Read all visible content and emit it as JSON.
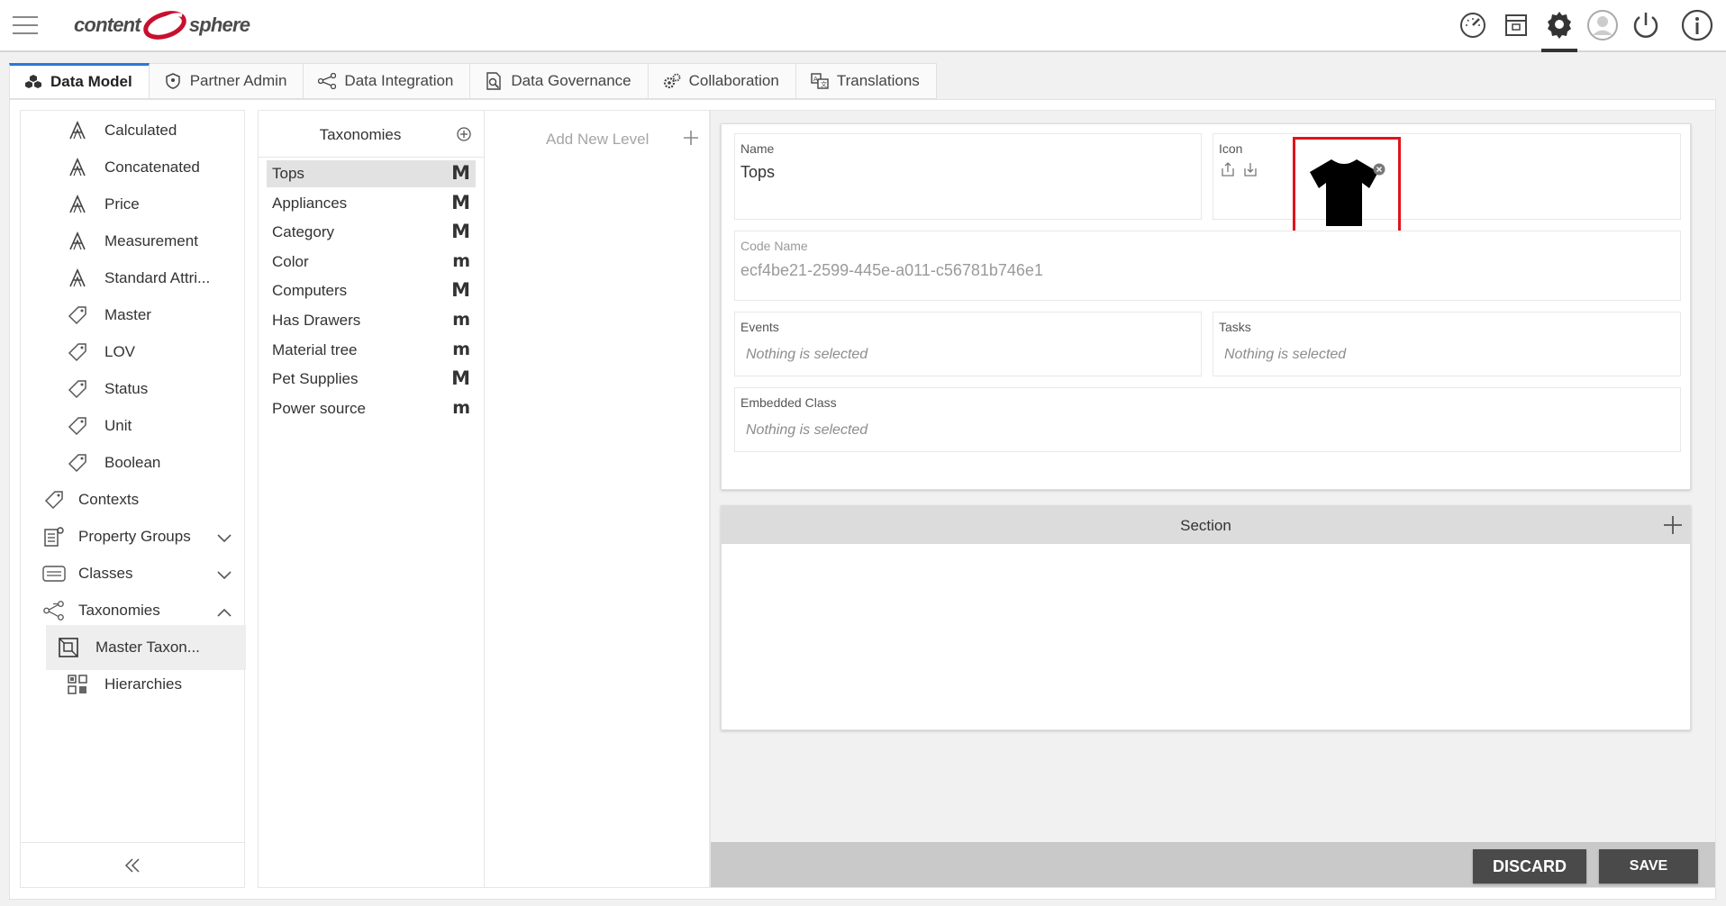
{
  "brand": {
    "logo_left": "content",
    "logo_right": "sphere",
    "logo_accent": "#c8102e"
  },
  "header_icons": [
    "dashboard-icon",
    "archive-icon",
    "gear-icon",
    "user-avatar-icon",
    "power-icon",
    "info-icon"
  ],
  "tabs": [
    {
      "label": "Data Model",
      "icon": "cubes-icon",
      "active": true
    },
    {
      "label": "Partner Admin",
      "icon": "shield-icon"
    },
    {
      "label": "Data Integration",
      "icon": "share-nodes-icon"
    },
    {
      "label": "Data Governance",
      "icon": "document-search-icon"
    },
    {
      "label": "Collaboration",
      "icon": "gears-icon"
    },
    {
      "label": "Translations",
      "icon": "translate-icon"
    }
  ],
  "sidebar": {
    "items": [
      {
        "label": "Calculated",
        "icon": "attribute-a-icon"
      },
      {
        "label": "Concatenated",
        "icon": "attribute-a-icon"
      },
      {
        "label": "Price",
        "icon": "attribute-a-icon"
      },
      {
        "label": "Measurement",
        "icon": "attribute-a-icon"
      },
      {
        "label": "Standard Attri...",
        "icon": "attribute-a-icon"
      },
      {
        "label": "Master",
        "icon": "tag-icon"
      },
      {
        "label": "LOV",
        "icon": "tag-icon"
      },
      {
        "label": "Status",
        "icon": "tag-icon"
      },
      {
        "label": "Unit",
        "icon": "tag-icon"
      },
      {
        "label": "Boolean",
        "icon": "tag-icon"
      },
      {
        "label": "Contexts",
        "icon": "tag-icon"
      },
      {
        "label": "Property Groups",
        "icon": "property-groups-icon"
      },
      {
        "label": "Classes",
        "icon": "classes-icon"
      },
      {
        "label": "Taxonomies",
        "icon": "taxonomy-icon"
      },
      {
        "label": "Master Taxon...",
        "icon": "master-taxonomy-icon",
        "selected": true
      },
      {
        "label": "Hierarchies",
        "icon": "hierarchies-icon"
      }
    ]
  },
  "taxonomies": {
    "title": "Taxonomies",
    "items": [
      {
        "label": "Tops",
        "badge": "M",
        "selected": true
      },
      {
        "label": "Appliances",
        "badge": "M"
      },
      {
        "label": "Category",
        "badge": "M"
      },
      {
        "label": "Color",
        "badge": "m"
      },
      {
        "label": "Computers",
        "badge": "M"
      },
      {
        "label": "Has Drawers",
        "badge": "m"
      },
      {
        "label": "Material tree",
        "badge": "m"
      },
      {
        "label": "Pet Supplies",
        "badge": "M"
      },
      {
        "label": "Power source",
        "badge": "m"
      }
    ]
  },
  "levels": {
    "add_label": "Add New Level"
  },
  "detail": {
    "name_label": "Name",
    "name_value": "Tops",
    "icon_label": "Icon",
    "icon_value": "t-shirt-icon",
    "code_name_label": "Code Name",
    "code_name_value": "ecf4be21-2599-445e-a011-c56781b746e1",
    "events_label": "Events",
    "events_placeholder": "Nothing is selected",
    "tasks_label": "Tasks",
    "tasks_placeholder": "Nothing is selected",
    "embedded_label": "Embedded Class",
    "embedded_placeholder": "Nothing is selected",
    "section_title": "Section",
    "highlight_color": "#e0141c"
  },
  "footer": {
    "discard_label": "DISCARD",
    "save_label": "SAVE"
  }
}
